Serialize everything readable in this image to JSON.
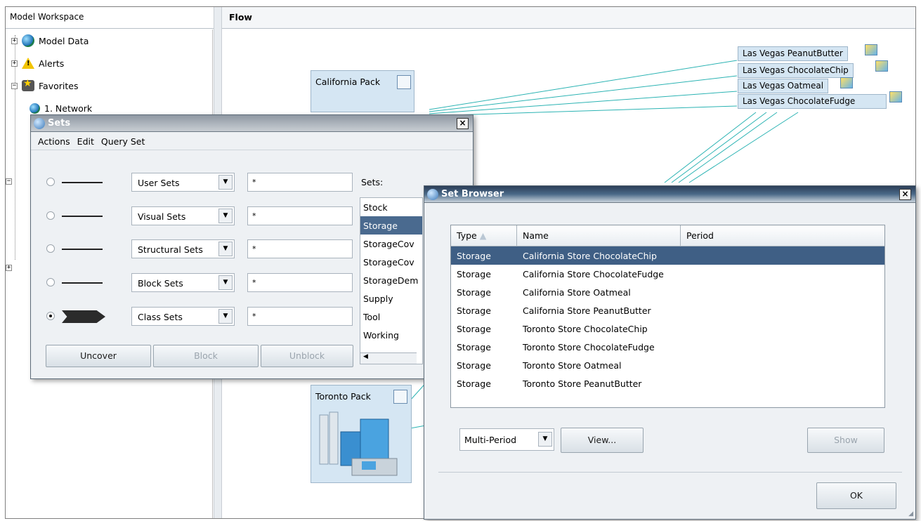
{
  "workspace": {
    "title": "Model Workspace",
    "tree": [
      {
        "label": "Model Data"
      },
      {
        "label": "Alerts"
      },
      {
        "label": "Favorites"
      },
      {
        "label": "1. Network"
      }
    ]
  },
  "flow": {
    "title": "Flow",
    "nodes": {
      "california": "California Pack",
      "toronto": "Toronto Pack"
    },
    "stores": [
      "Las Vegas PeanutButter",
      "Las Vegas ChocolateChip",
      "Las Vegas Oatmeal",
      "Las Vegas ChocolateFudge"
    ]
  },
  "sets_dialog": {
    "title": "Sets",
    "close": "×",
    "menu": [
      "Actions",
      "Edit",
      "Query Set"
    ],
    "sets_label": "Sets:",
    "rows": [
      {
        "type": "User Sets",
        "filter": "*",
        "checked": false
      },
      {
        "type": "Visual Sets",
        "filter": "*",
        "checked": false
      },
      {
        "type": "Structural Sets",
        "filter": "*",
        "checked": false
      },
      {
        "type": "Block Sets",
        "filter": "*",
        "checked": false
      },
      {
        "type": "Class Sets",
        "filter": "*",
        "checked": true
      }
    ],
    "list": [
      "Stock",
      "Storage",
      "StorageCov",
      "StorageCov",
      "StorageDem",
      "Supply",
      "Tool",
      "Working"
    ],
    "selected_list_item": "Storage",
    "buttons": {
      "uncover": "Uncover",
      "block": "Block",
      "unblock": "Unblock"
    }
  },
  "set_browser": {
    "title": "Set Browser",
    "close": "×",
    "columns": [
      "Type",
      "Name",
      "Period"
    ],
    "rows": [
      {
        "type": "Storage",
        "name": "California Store ChocolateChip",
        "period": ""
      },
      {
        "type": "Storage",
        "name": "California Store ChocolateFudge",
        "period": ""
      },
      {
        "type": "Storage",
        "name": "California Store Oatmeal",
        "period": ""
      },
      {
        "type": "Storage",
        "name": "California Store PeanutButter",
        "period": ""
      },
      {
        "type": "Storage",
        "name": "Toronto Store ChocolateChip",
        "period": ""
      },
      {
        "type": "Storage",
        "name": "Toronto Store ChocolateFudge",
        "period": ""
      },
      {
        "type": "Storage",
        "name": "Toronto Store Oatmeal",
        "period": ""
      },
      {
        "type": "Storage",
        "name": "Toronto Store PeanutButter",
        "period": ""
      }
    ],
    "period_mode": "Multi-Period",
    "view_button": "View...",
    "show_button": "Show",
    "ok_button": "OK"
  },
  "colors": {
    "selection": "#3f5f85",
    "flow_line": "#2bb3b3",
    "node_fill": "#d5e6f3"
  }
}
